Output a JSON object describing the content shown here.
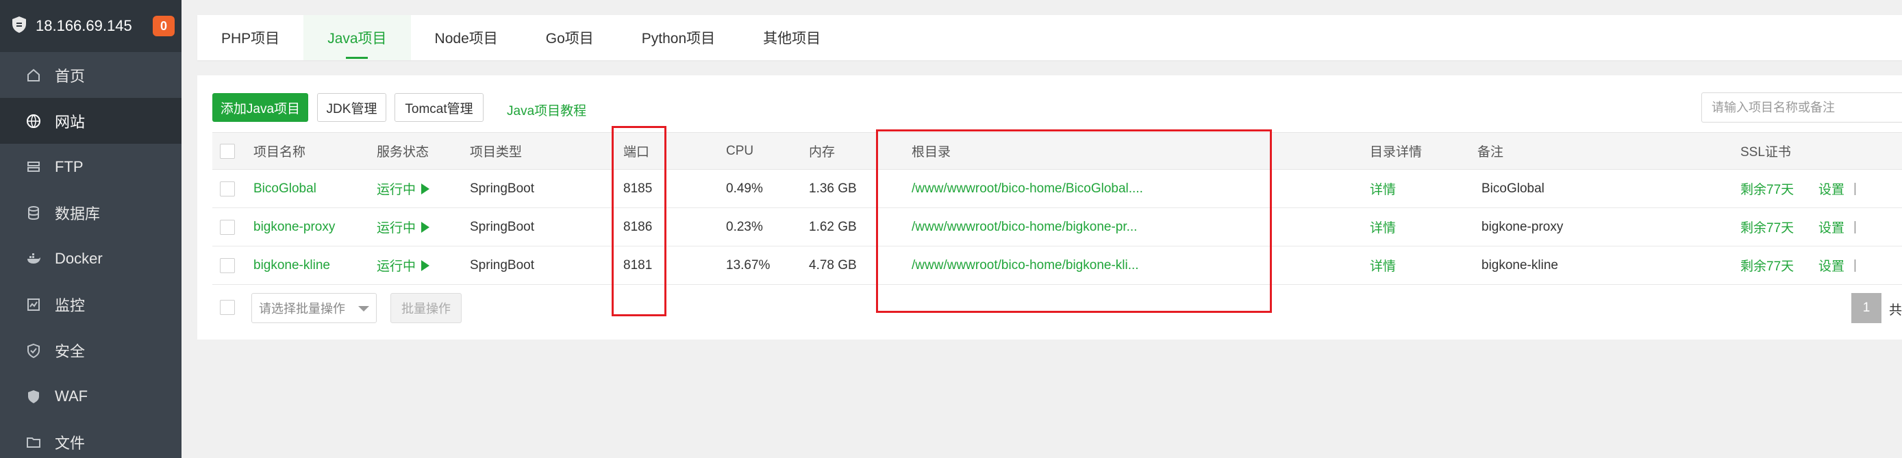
{
  "sidebar": {
    "host": "18.166.69.145",
    "badge": "0",
    "items": [
      {
        "label": "首页",
        "icon": "home-icon"
      },
      {
        "label": "网站",
        "icon": "globe-icon",
        "active": true
      },
      {
        "label": "FTP",
        "icon": "ftp-icon"
      },
      {
        "label": "数据库",
        "icon": "database-icon"
      },
      {
        "label": "Docker",
        "icon": "docker-icon"
      },
      {
        "label": "监控",
        "icon": "monitor-icon"
      },
      {
        "label": "安全",
        "icon": "shield-icon"
      },
      {
        "label": "WAF",
        "icon": "waf-shield-icon"
      },
      {
        "label": "文件",
        "icon": "folder-icon"
      }
    ]
  },
  "tabs": [
    {
      "label": "PHP项目"
    },
    {
      "label": "Java项目",
      "active": true
    },
    {
      "label": "Node项目"
    },
    {
      "label": "Go项目"
    },
    {
      "label": "Python项目"
    },
    {
      "label": "其他项目"
    }
  ],
  "toolbar": {
    "add_label": "添加Java项目",
    "jdk_label": "JDK管理",
    "tomcat_label": "Tomcat管理",
    "tutorial_label": "Java项目教程",
    "search_placeholder": "请输入项目名称或备注"
  },
  "table": {
    "headers": {
      "name": "项目名称",
      "status": "服务状态",
      "type": "项目类型",
      "port": "端口",
      "cpu": "CPU",
      "mem": "内存",
      "root": "根目录",
      "detail": "目录详情",
      "remark": "备注",
      "ssl": "SSL证书"
    },
    "rows": [
      {
        "name": "BicoGlobal",
        "status": "运行中",
        "type": "SpringBoot",
        "port": "8185",
        "cpu": "0.49%",
        "mem": "1.36 GB",
        "root": "/www/wwwroot/bico-home/BicoGlobal....",
        "detail": "详情",
        "remark": "BicoGlobal",
        "ssl": "剩余77天",
        "action": "设置",
        "sep": "|"
      },
      {
        "name": "bigkone-proxy",
        "status": "运行中",
        "type": "SpringBoot",
        "port": "8186",
        "cpu": "0.23%",
        "mem": "1.62 GB",
        "root": "/www/wwwroot/bico-home/bigkone-pr...",
        "detail": "详情",
        "remark": "bigkone-proxy",
        "ssl": "剩余77天",
        "action": "设置",
        "sep": "|"
      },
      {
        "name": "bigkone-kline",
        "status": "运行中",
        "type": "SpringBoot",
        "port": "8181",
        "cpu": "13.67%",
        "mem": "4.78 GB",
        "root": "/www/wwwroot/bico-home/bigkone-kli...",
        "detail": "详情",
        "remark": "bigkone-kline",
        "ssl": "剩余77天",
        "action": "设置",
        "sep": "|"
      }
    ]
  },
  "footer": {
    "batch_select": "请选择批量操作",
    "batch_button": "批量操作",
    "page": "1",
    "total": "共"
  },
  "colors": {
    "accent": "#20a53a",
    "sidebar_bg": "#3c444d",
    "highlight": "#e51c23"
  }
}
